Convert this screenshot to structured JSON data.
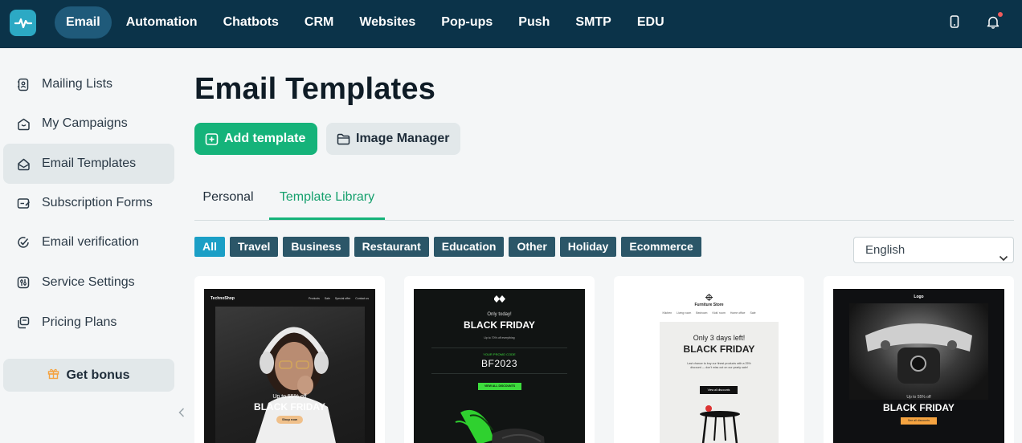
{
  "nav": {
    "items": [
      {
        "label": "Email",
        "active": true
      },
      {
        "label": "Automation"
      },
      {
        "label": "Chatbots"
      },
      {
        "label": "CRM"
      },
      {
        "label": "Websites"
      },
      {
        "label": "Pop-ups"
      },
      {
        "label": "Push"
      },
      {
        "label": "SMTP"
      },
      {
        "label": "EDU"
      }
    ],
    "icons": [
      "mobile-icon",
      "bell-icon"
    ]
  },
  "sidebar": {
    "items": [
      {
        "label": "Mailing Lists",
        "icon": "address-book-icon"
      },
      {
        "label": "My Campaigns",
        "icon": "campaign-icon"
      },
      {
        "label": "Email Templates",
        "icon": "template-icon",
        "active": true
      },
      {
        "label": "Subscription Forms",
        "icon": "form-icon"
      },
      {
        "label": "Email verification",
        "icon": "check-circle-icon"
      },
      {
        "label": "Service Settings",
        "icon": "settings-icon"
      },
      {
        "label": "Pricing Plans",
        "icon": "stack-icon"
      }
    ],
    "bonus_label": "Get bonus"
  },
  "main": {
    "title": "Email Templates",
    "add_template_label": "Add template",
    "image_manager_label": "Image Manager",
    "tabs": [
      {
        "label": "Personal"
      },
      {
        "label": "Template Library",
        "active": true
      }
    ],
    "filters": [
      {
        "label": "All",
        "active": true
      },
      {
        "label": "Travel"
      },
      {
        "label": "Business"
      },
      {
        "label": "Restaurant"
      },
      {
        "label": "Education"
      },
      {
        "label": "Other"
      },
      {
        "label": "Holiday"
      },
      {
        "label": "Ecommerce"
      }
    ],
    "language": "English"
  },
  "templates": [
    {
      "brand": "TechnoShop",
      "menu": [
        "Products",
        "Sale",
        "Special offer",
        "Contact us"
      ],
      "offer": "Up to 55% off",
      "headline": "BLACK FRIDAY",
      "cta": "Shop now"
    },
    {
      "top": "Only today!",
      "headline": "BLACK FRIDAY",
      "sub": "Up to 70% off everything",
      "code_label": "YOUR PROMO CODE",
      "code": "BF2023",
      "cta": "VIEW ALL DISCOUNTS"
    },
    {
      "brand": "Furniture Store",
      "menu": [
        "Kitchen",
        "Living room",
        "Bedroom",
        "Kids' room",
        "Home office",
        "Sale"
      ],
      "top": "Only 3 days left!",
      "headline": "BLACK FRIDAY",
      "body": "Last chance to buy our finest products with a 25% discount — don't miss out on our yearly sale!",
      "cta": "View all discounts"
    },
    {
      "brand": "Logo",
      "offer": "Up to 55% off",
      "headline": "BLACK FRIDAY",
      "cta": "See all discounts"
    }
  ],
  "colors": {
    "topbar": "#0b3349",
    "accent_green": "#15b37a",
    "chip_dark": "#2b5668",
    "chip_active": "#1b9fc6",
    "promo_green": "#3ddc3d",
    "orange": "#f5a340"
  }
}
